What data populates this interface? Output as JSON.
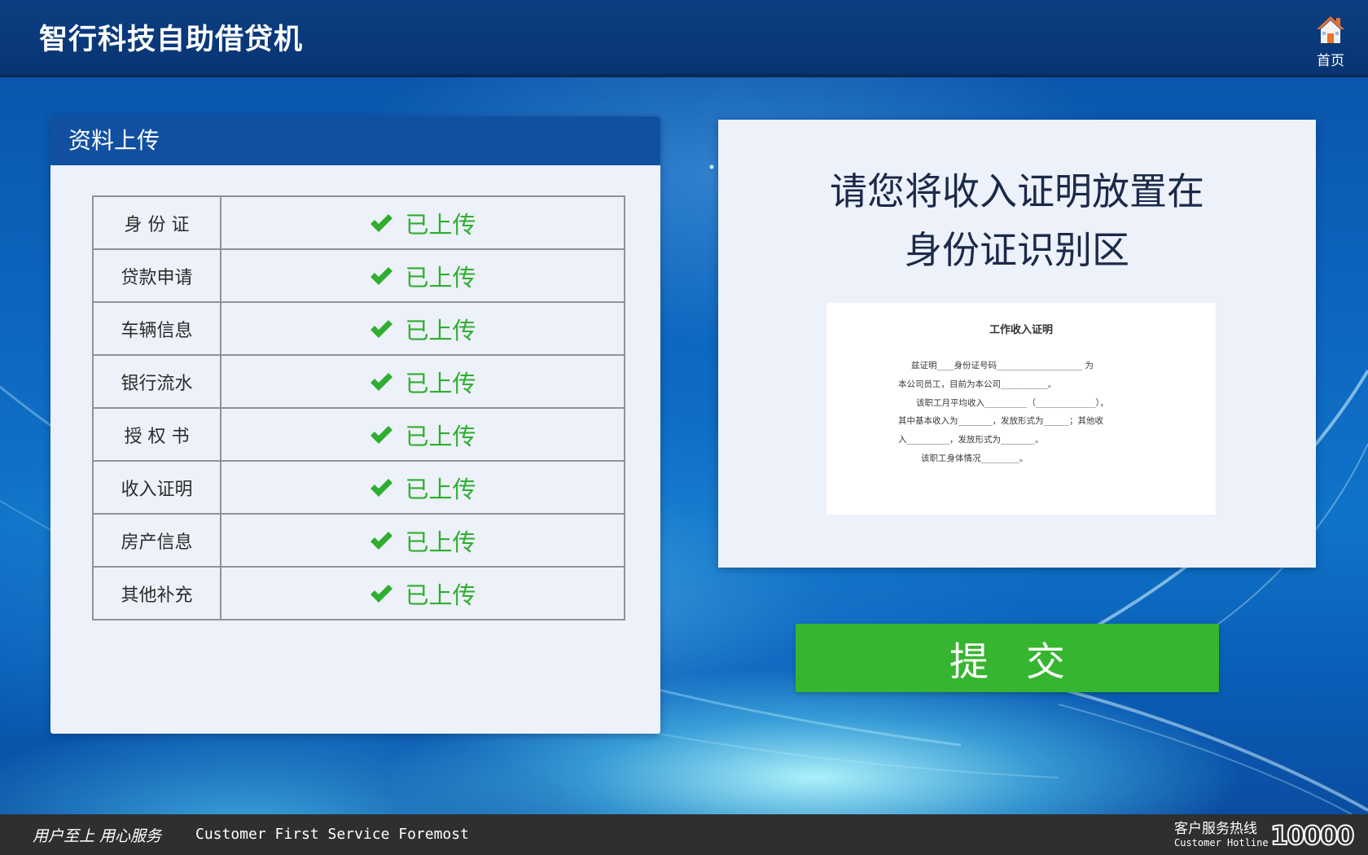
{
  "header": {
    "title": "智行科技自助借贷机",
    "home_label": "首页",
    "home_icon": "home-icon"
  },
  "upload_panel": {
    "title": "资料上传",
    "rows": [
      {
        "name": "身 份 证",
        "status": "已上传"
      },
      {
        "name": "贷款申请",
        "status": "已上传"
      },
      {
        "name": "车辆信息",
        "status": "已上传"
      },
      {
        "name": "银行流水",
        "status": "已上传"
      },
      {
        "name": "授 权 书",
        "status": "已上传"
      },
      {
        "name": "收入证明",
        "status": "已上传"
      },
      {
        "name": "房产信息",
        "status": "已上传"
      },
      {
        "name": "其他补充",
        "status": "已上传"
      }
    ]
  },
  "instruction": {
    "line1": "请您将收入证明放置在",
    "line2": "身份证识别区"
  },
  "document_preview": {
    "title": "工作收入证明",
    "lines": [
      "兹证明____身份证号码____________________ 为",
      "本公司员工，目前为本公司___________。",
      "该职工月平均收入__________（______________），",
      "其中基本收入为________，发放形式为______；其他收",
      "入__________，发放形式为________。",
      "该职工身体情况_________。"
    ]
  },
  "submit": {
    "label": "提交"
  },
  "footer": {
    "slogan_cn": "用户至上 用心服务",
    "slogan_en": "Customer First Service Foremost",
    "hotline_cn": "客户服务热线",
    "hotline_en": "Customer Hotline",
    "hotline_number": "10000"
  },
  "colors": {
    "header_bg": "#0c3f82",
    "panel_header": "#1150a1",
    "success_green": "#2fae2f",
    "submit_green": "#36b530",
    "footer_bg": "#2e2f31"
  }
}
